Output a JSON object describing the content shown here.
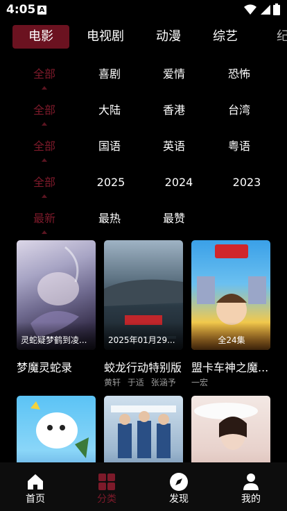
{
  "status": {
    "time": "4:05"
  },
  "tabs": [
    {
      "label": "电影",
      "active": true
    },
    {
      "label": "电视剧",
      "active": false
    },
    {
      "label": "动漫",
      "active": false
    },
    {
      "label": "综艺",
      "active": false
    },
    {
      "label": "纪",
      "active": false
    }
  ],
  "filters": {
    "genre": [
      "全部",
      "喜剧",
      "爱情",
      "恐怖"
    ],
    "region": [
      "全部",
      "大陆",
      "香港",
      "台湾"
    ],
    "language": [
      "全部",
      "国语",
      "英语",
      "粤语"
    ],
    "year": [
      "全部",
      "2025",
      "2024",
      "2023"
    ],
    "sort": [
      "最新",
      "最热",
      "最赞"
    ]
  },
  "cards": [
    {
      "badge": "灵蛇疑梦鹤到凌...",
      "title": "梦魔灵蛇录",
      "actors": []
    },
    {
      "badge": "2025年01月29...",
      "title": "蛟龙行动特别版",
      "actors": [
        "黄轩",
        "于适",
        "张涵予"
      ]
    },
    {
      "badge": "全24集",
      "title": "盟卡车神之魔...",
      "actors": [
        "一宏"
      ]
    },
    {
      "badge": "",
      "title": "",
      "actors": []
    },
    {
      "badge": "",
      "title": "",
      "actors": []
    },
    {
      "badge": "",
      "title": "",
      "actors": []
    }
  ],
  "nav": [
    {
      "label": "首页",
      "icon": "home-icon",
      "active": false
    },
    {
      "label": "分类",
      "icon": "grid-icon",
      "active": true
    },
    {
      "label": "发现",
      "icon": "compass-icon",
      "active": false
    },
    {
      "label": "我的",
      "icon": "user-icon",
      "active": false
    }
  ],
  "colors": {
    "accent": "#6b1220",
    "selected_text": "#7d1a2a",
    "background": "#000000"
  }
}
